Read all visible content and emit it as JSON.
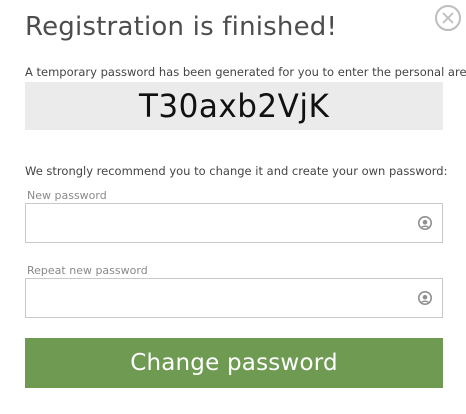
{
  "dialog": {
    "title": "Registration is finished!",
    "close_icon": "close-icon"
  },
  "temporary": {
    "hint": "A temporary password has been generated for you to enter the personal area:",
    "password": "T30axb2VjK"
  },
  "recommend": {
    "text": "We strongly recommend you to change it and create your own password:"
  },
  "new_password": {
    "label": "New password",
    "value": "",
    "placeholder": "",
    "toggle_icon": "eye-icon"
  },
  "repeat_password": {
    "label": "Repeat new password",
    "value": "",
    "placeholder": "",
    "toggle_icon": "eye-icon"
  },
  "submit": {
    "label": "Change password"
  },
  "colors": {
    "accent": "#6e9a52",
    "temp_box_bg": "#ebebeb",
    "input_border": "#c9c9c9",
    "close_ring": "#bdbdbd"
  }
}
